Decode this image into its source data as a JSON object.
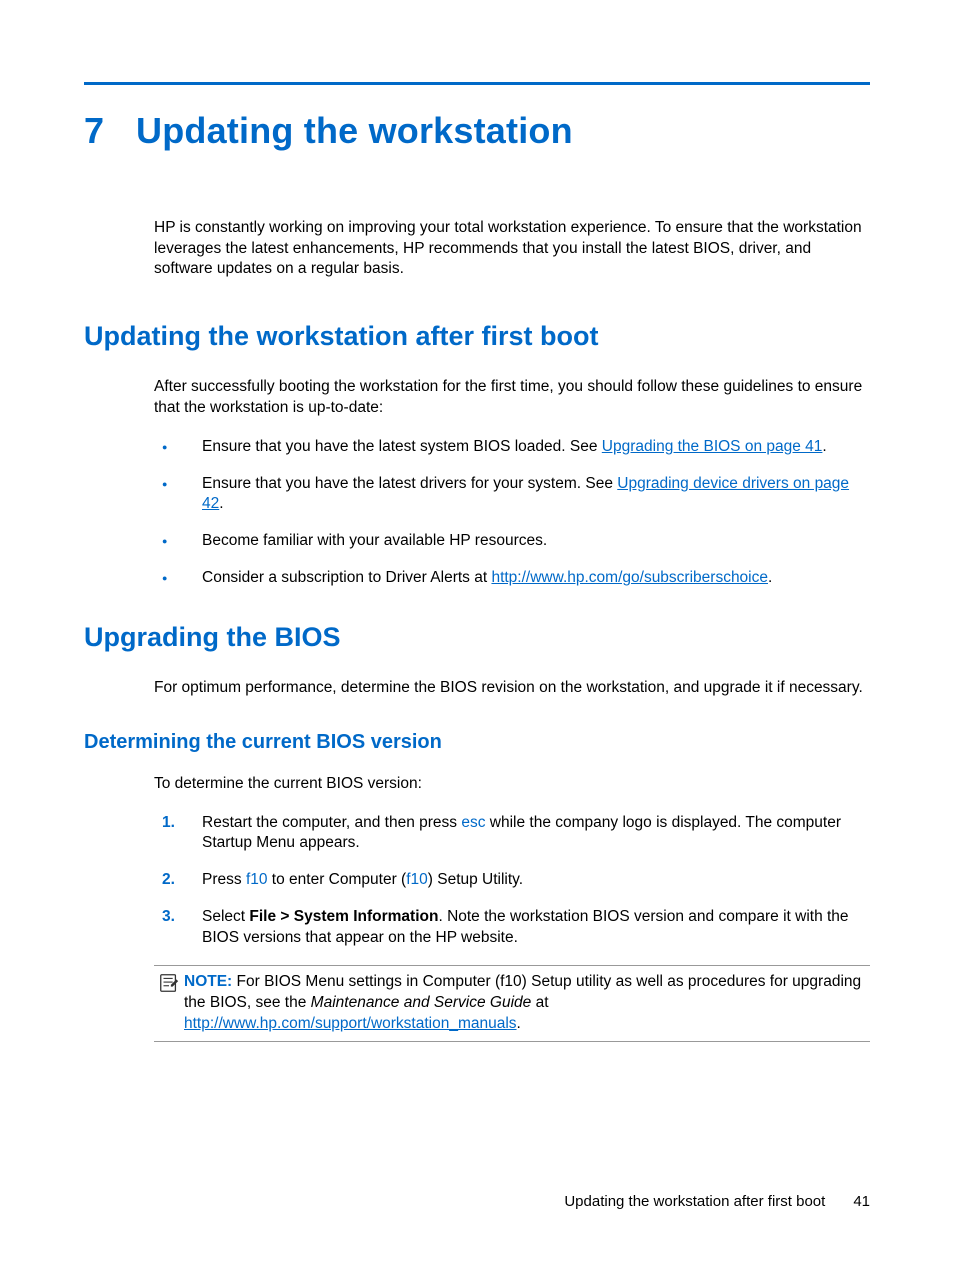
{
  "chapter": {
    "number": "7",
    "title": "Updating the workstation"
  },
  "intro": "HP is constantly working on improving your total workstation experience. To ensure that the workstation leverages the latest enhancements, HP recommends that you install the latest BIOS, driver, and software updates on a regular basis.",
  "section1": {
    "heading": "Updating the workstation after first boot",
    "intro": "After successfully booting the workstation for the first time, you should follow these guidelines to ensure that the workstation is up-to-date:",
    "bullets": {
      "b1_pre": "Ensure that you have the latest system BIOS loaded. See ",
      "b1_link": "Upgrading the BIOS on page 41",
      "b1_post": ".",
      "b2_pre": "Ensure that you have the latest drivers for your system. See ",
      "b2_link": "Upgrading device drivers on page 42",
      "b2_post": ".",
      "b3": "Become familiar with your available HP resources.",
      "b4_pre": "Consider a subscription to Driver Alerts at ",
      "b4_link": "http://www.hp.com/go/subscriberschoice",
      "b4_post": "."
    }
  },
  "section2": {
    "heading": "Upgrading the BIOS",
    "intro": "For optimum performance, determine the BIOS revision on the workstation, and upgrade it if necessary.",
    "sub": {
      "heading": "Determining the current BIOS version",
      "intro": "To determine the current BIOS version:",
      "steps": {
        "s1_pre": "Restart the computer, and then press ",
        "s1_key": "esc",
        "s1_post": " while the company logo is displayed. The computer Startup Menu appears.",
        "s2_pre": "Press ",
        "s2_key1": "f10",
        "s2_mid": " to enter Computer (",
        "s2_key2": "f10",
        "s2_post": ") Setup Utility.",
        "s3_pre": "Select ",
        "s3_bold": "File > System Information",
        "s3_post": ". Note the workstation BIOS version and compare it with the BIOS versions that appear on the HP website."
      },
      "note": {
        "label": "NOTE:",
        "pre": "   For BIOS Menu settings in Computer (f10) Setup utility as well as procedures for upgrading the BIOS, see the ",
        "italic": "Maintenance and Service Guide",
        "mid": " at ",
        "link": "http://www.hp.com/support/workstation_manuals",
        "post": "."
      }
    }
  },
  "footer": {
    "text": "Updating the workstation after first boot",
    "page": "41"
  }
}
